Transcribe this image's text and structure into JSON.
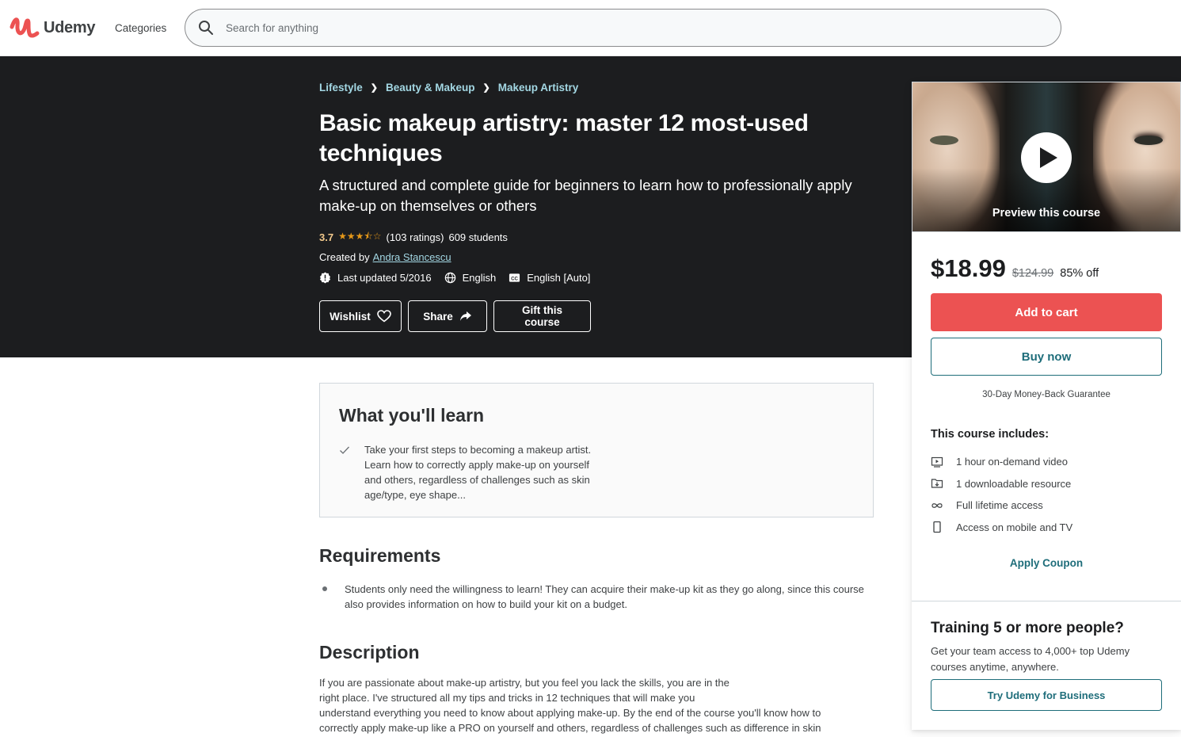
{
  "header": {
    "logo_text": "Udemy",
    "categories_label": "Categories",
    "search_placeholder": "Search for anything"
  },
  "hero": {
    "breadcrumb": [
      "Lifestyle",
      "Beauty & Makeup",
      "Makeup Artistry"
    ],
    "title": "Basic makeup artistry: master 12 most-used techniques",
    "subtitle": "A structured and complete guide for beginners to learn how to professionally apply make-up on themselves or others",
    "rating": "3.7",
    "stars": "★★★⯪☆",
    "ratings_count": "(103 ratings)",
    "students": "609 students",
    "created_by_label": "Created by",
    "author": "Andra Stancescu",
    "last_updated": "Last updated 5/2016",
    "language": "English",
    "captions": "English [Auto]",
    "buttons": {
      "wishlist": "Wishlist",
      "share": "Share",
      "gift": "Gift this course"
    }
  },
  "sidebar": {
    "preview_label": "Preview this course",
    "price": "$18.99",
    "original_price": "$124.99",
    "discount": "85% off",
    "add_to_cart": "Add to cart",
    "buy_now": "Buy now",
    "guarantee": "30-Day Money-Back Guarantee",
    "includes_title": "This course includes:",
    "includes": [
      {
        "icon": "video-icon",
        "text": "1 hour on-demand video"
      },
      {
        "icon": "download-file-icon",
        "text": "1 downloadable resource"
      },
      {
        "icon": "infinity-icon",
        "text": "Full lifetime access"
      },
      {
        "icon": "mobile-icon",
        "text": "Access on mobile and TV"
      }
    ],
    "apply_coupon": "Apply Coupon",
    "business": {
      "title": "Training 5 or more people?",
      "text": "Get your team access to 4,000+ top Udemy courses anytime, anywhere.",
      "button": "Try Udemy for Business"
    }
  },
  "main": {
    "learn": {
      "title": "What you'll learn",
      "items": [
        "Take your first steps to becoming a makeup artist. Learn how to correctly apply make-up on yourself and others, regardless of challenges such as skin age/type, eye shape..."
      ]
    },
    "requirements": {
      "title": "Requirements",
      "items": [
        "Students only need the willingness to learn! They can acquire their make-up kit as they go along, since this course also provides information on how to build your kit on a budget."
      ]
    },
    "description": {
      "title": "Description",
      "lines": [
        "If you are passionate about make-up artistry, but you feel you lack the skills, you are in the",
        "right place. I've structured all my tips and tricks in 12 techniques that will make you",
        "understand everything you need to know about applying make-up. By the end of the course you'll know how to",
        "correctly apply make-up like a PRO on yourself and others, regardless of challenges such as difference in skin"
      ]
    }
  },
  "colors": {
    "brand_red": "#ec5252",
    "hero_bg": "#1c1d1f",
    "link_teal": "#1e6d7a",
    "breadcrumb_link": "#a3d7e3",
    "rating_orange": "#f3ca8c",
    "star_color": "#e59819"
  }
}
